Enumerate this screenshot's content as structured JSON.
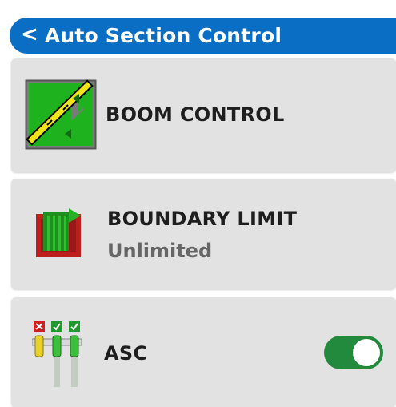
{
  "header": {
    "back_glyph": "<",
    "title": "Auto Section Control",
    "color": "#0a6fc4"
  },
  "items": [
    {
      "label": "BOOM CONTROL",
      "icon": "boom-control-icon"
    },
    {
      "label": "BOUNDARY LIMIT",
      "value": "Unlimited",
      "icon": "boundary-limit-icon"
    },
    {
      "label": "ASC",
      "icon": "asc-sections-icon",
      "toggle": {
        "state": "on",
        "color": "#218a3c"
      }
    }
  ]
}
